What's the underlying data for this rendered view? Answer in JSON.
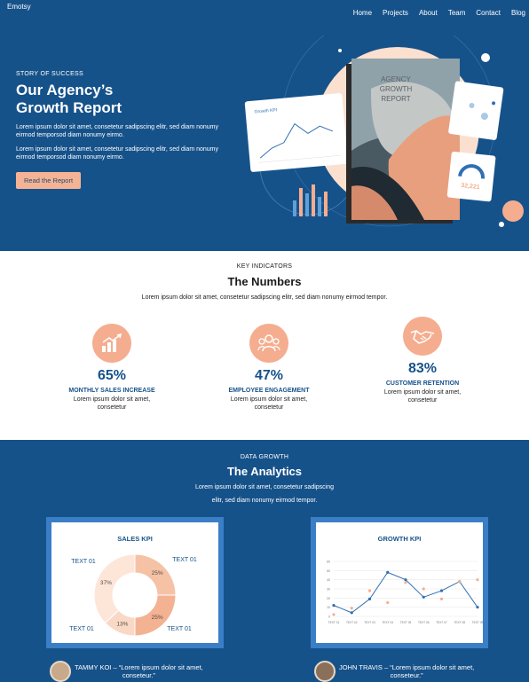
{
  "header": {
    "logo": "Emotsy",
    "nav": [
      "Home",
      "Projects",
      "About",
      "Team",
      "Contact",
      "Blog"
    ]
  },
  "hero": {
    "kicker": "STORY OF SUCCESS",
    "title_line1": "Our Agency’s",
    "title_line2": "Growth Report",
    "para1": "Lorem ipsum dolor sit amet, consetetur sadipscing elitr, sed diam nonumy eirmod temporsod diam nonumy eirmo.",
    "para2": "Lorem ipsum dolor sit amet, consetetur sadipscing elitr, sed diam nonumy eirmod temporsod diam nonumy eirmo.",
    "button": "Read the Report",
    "book_text": [
      "AGENCY",
      "GROWTH",
      "REPORT"
    ],
    "small_chart_title": "Growth KPI",
    "badge_value": "32,221"
  },
  "numbers": {
    "kicker": "KEY INDICATORS",
    "title": "The Numbers",
    "subtitle": "Lorem ipsum dolor sit amet, consetetur sadipscing elitr, sed diam nonumy eirmod tempor.",
    "stats": [
      {
        "value": "65%",
        "label": "MONTHLY SALES INCREASE",
        "desc1": "Lorem ipsum dolor sit amet,",
        "desc2": "consetetur",
        "icon": "chart-growth-icon"
      },
      {
        "value": "47%",
        "label": "EMPLOYEE ENGAGEMENT",
        "desc1": "Lorem ipsum dolor sit amet,",
        "desc2": "consetetur",
        "icon": "team-icon"
      },
      {
        "value": "83%",
        "label": "CUSTOMER RETENTION",
        "desc1": "Lorem ipsum dolor sit amet,",
        "desc2": "consetetur",
        "icon": "handshake-icon"
      }
    ]
  },
  "analytics": {
    "kicker": "DATA GROWTH",
    "title": "The Analytics",
    "subtitle1": "Lorem ipsum dolor sit amet, consetetur sadipscing",
    "subtitle2": "elitr, sed diam nonumy eirmod tempor.",
    "quotes": [
      {
        "line1": "TAMMY KOI – “Lorem ipsum dolor sit amet,",
        "line2": "conseteur.”"
      },
      {
        "line1": "JOHN TRAVIS – “Lorem ipsum dolor sit amet,",
        "line2": "conseteur.”"
      }
    ]
  },
  "colors": {
    "primary": "#16528a",
    "accent": "#f5ad8f",
    "panel": "#3a7ec6"
  },
  "chart_data": [
    {
      "type": "pie",
      "title": "SALES KPI",
      "categories": [
        "TEXT 01",
        "TEXT 01",
        "TEXT 01",
        "TEXT 01"
      ],
      "values": [
        25,
        25,
        13,
        37
      ],
      "value_labels": [
        "25%",
        "25%",
        "13%",
        "37%"
      ],
      "colors": [
        "#f5c2a6",
        "#f3b292",
        "#f9d8c6",
        "#fde6d8"
      ],
      "donut": true
    },
    {
      "type": "line",
      "title": "GROWTH KPI",
      "categories": [
        "TEXT 01",
        "TEXT 02",
        "TEXT 03",
        "TEXT 04",
        "TEXT 05",
        "TEXT 06",
        "TEXT 07",
        "TEXT 08",
        "TEXT 09"
      ],
      "yticks": [
        "0",
        "10",
        "20",
        "30",
        "40",
        "50",
        "60"
      ],
      "ylim": [
        0,
        60
      ],
      "series": [
        {
          "values": [
            12,
            4,
            19,
            48,
            40,
            21,
            28,
            38,
            10
          ],
          "color": "#2f6fb3"
        },
        {
          "values": [
            2,
            9,
            28,
            15,
            37,
            30,
            19,
            38,
            40
          ],
          "color": "#f5ad8f"
        }
      ],
      "grid": true
    }
  ]
}
